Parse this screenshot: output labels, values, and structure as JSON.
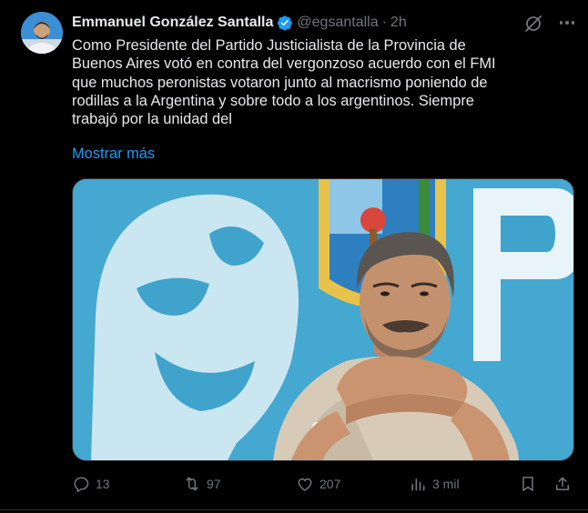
{
  "tweet": {
    "author_name": "Emmanuel González Santalla",
    "handle": "@egsantalla",
    "separator": "·",
    "time": "2h",
    "text_lines": [
      "Como Presidente del Partido Justicialista de la Provincia de",
      "Buenos Aires votó en contra del vergonzoso acuerdo con el FMI",
      "que muchos peronistas votaron junto al macrismo poniendo de",
      "rodillas a la Argentina y sobre todo a los argentinos. Siempre",
      "trabajó por la unidad del"
    ],
    "show_more": "Mostrar más"
  },
  "actions": {
    "replies": "13",
    "reposts": "97",
    "likes": "207",
    "views": "3 mil"
  },
  "colors": {
    "background": "#000000",
    "text": "#e7e9ea",
    "muted": "#71767b",
    "link": "#1d9bf0",
    "verified": "#1d9bf0",
    "border": "#2f3336"
  },
  "icons": [
    "grok-icon",
    "more-icon",
    "verified-badge-icon",
    "reply-icon",
    "repost-icon",
    "like-icon",
    "views-icon",
    "bookmark-icon",
    "share-icon"
  ]
}
